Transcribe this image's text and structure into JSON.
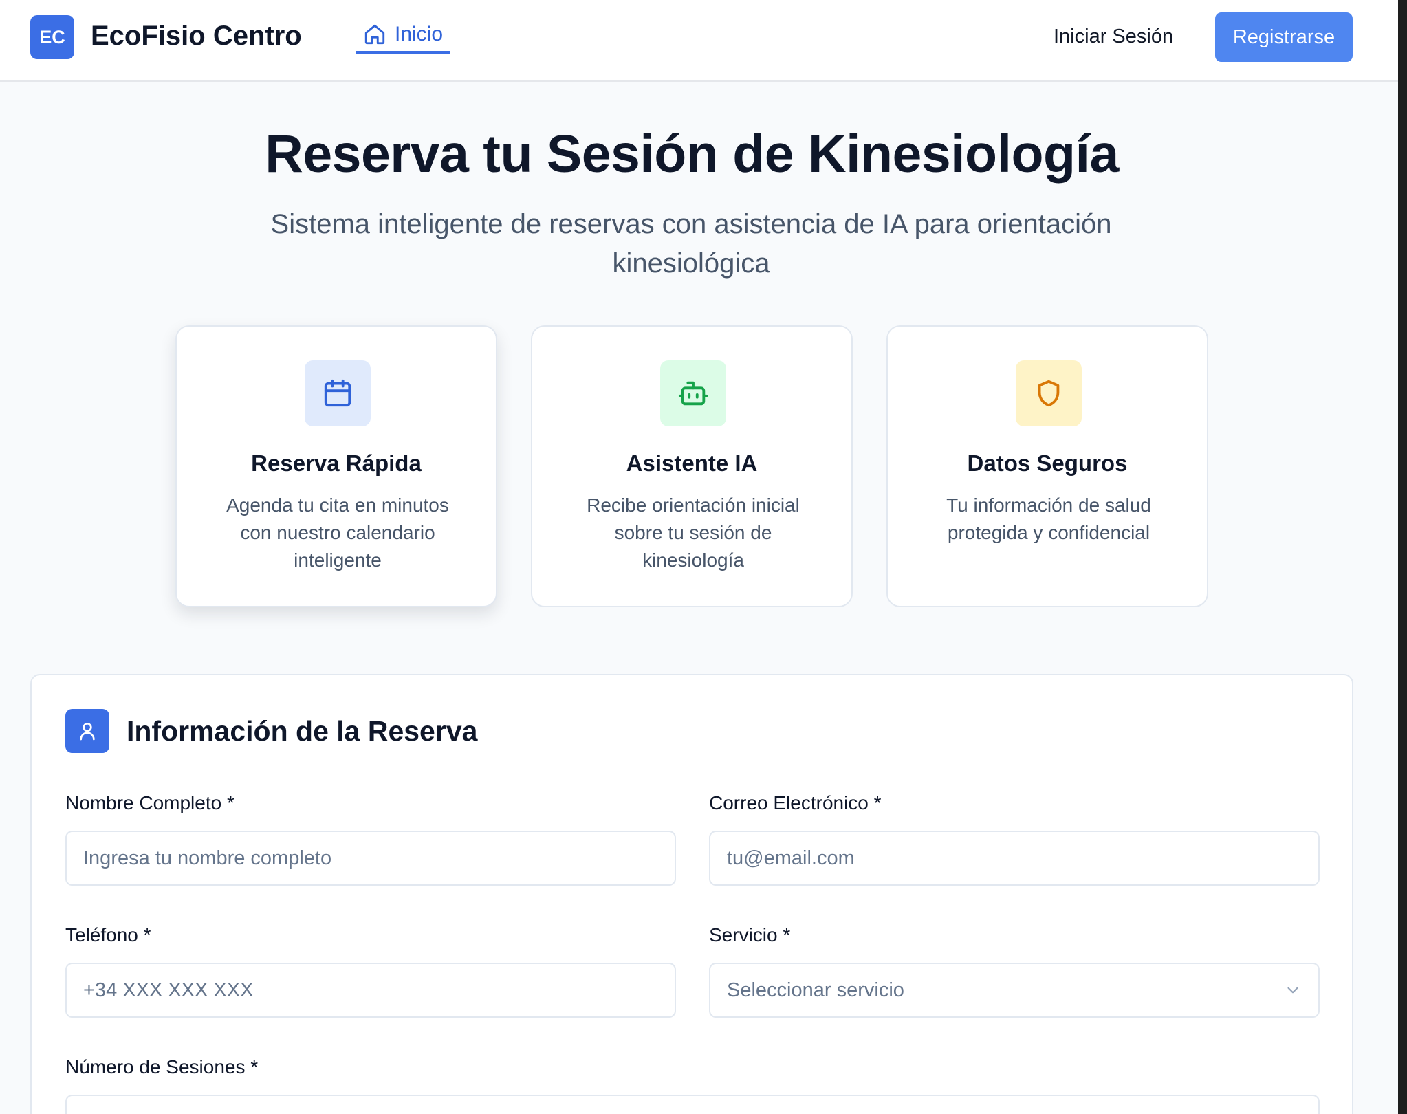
{
  "header": {
    "logo_initials": "EC",
    "brand": "EcoFisio Centro",
    "nav_home": "Inicio",
    "login": "Iniciar Sesión",
    "register": "Registrarse"
  },
  "hero": {
    "title": "Reserva tu Sesión de Kinesiología",
    "subtitle": "Sistema inteligente de reservas con asistencia de IA para orientación kinesiológica"
  },
  "features": [
    {
      "icon": "calendar-icon",
      "title": "Reserva Rápida",
      "description": "Agenda tu cita en minutos con nuestro calendario inteligente",
      "icon_bg": "#e0eafc",
      "icon_color": "#2f62d8"
    },
    {
      "icon": "bot-icon",
      "title": "Asistente IA",
      "description": "Recibe orientación inicial sobre tu sesión de kinesiología",
      "icon_bg": "#dcfce7",
      "icon_color": "#16a34a"
    },
    {
      "icon": "shield-icon",
      "title": "Datos Seguros",
      "description": "Tu información de salud protegida y confidencial",
      "icon_bg": "#fef3c7",
      "icon_color": "#d97706"
    }
  ],
  "form": {
    "title": "Información de la Reserva",
    "fields": {
      "name": {
        "label": "Nombre Completo *",
        "placeholder": "Ingresa tu nombre completo"
      },
      "email": {
        "label": "Correo Electrónico *",
        "placeholder": "tu@email.com"
      },
      "phone": {
        "label": "Teléfono *",
        "placeholder": "+34 XXX XXX XXX"
      },
      "service": {
        "label": "Servicio *",
        "placeholder": "Seleccionar servicio"
      },
      "sessions": {
        "label": "Número de Sesiones *"
      }
    }
  },
  "colors": {
    "accent": "#3b6ee5",
    "register_button": "#4f86f0",
    "page_bg": "#f8fafc"
  }
}
